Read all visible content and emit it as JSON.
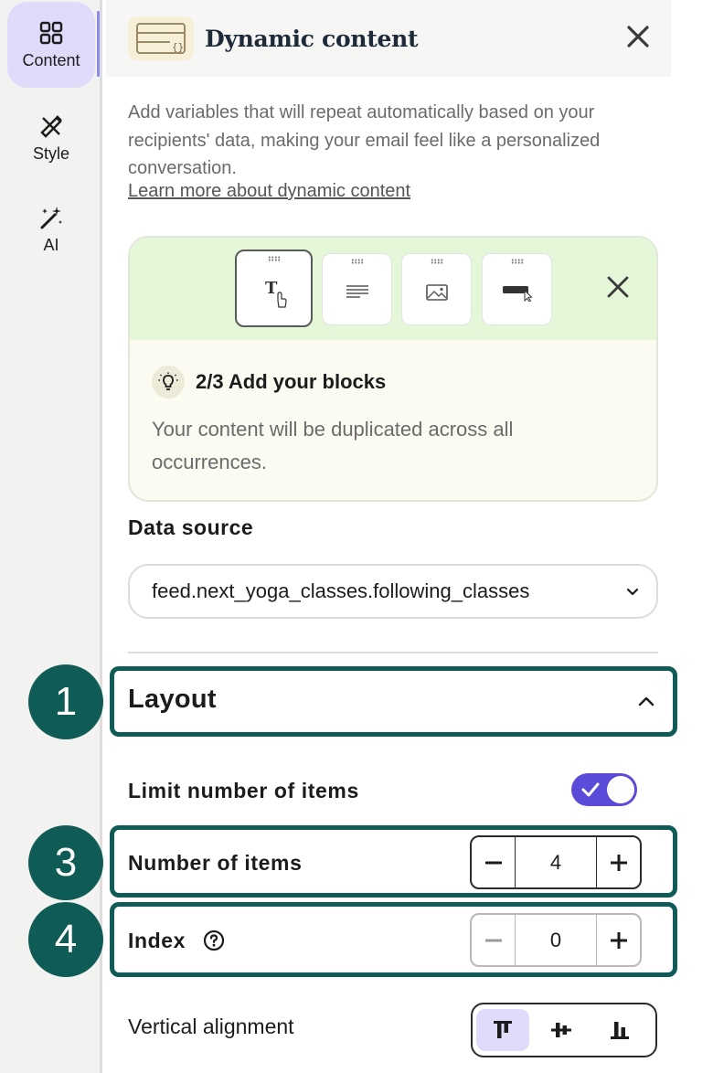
{
  "sidebar": {
    "items": [
      {
        "label": "Content",
        "icon": "grid-icon",
        "active": true
      },
      {
        "label": "Style",
        "icon": "pen-ruler-icon",
        "active": false
      },
      {
        "label": "AI",
        "icon": "magic-wand-icon",
        "active": false
      }
    ]
  },
  "header": {
    "title": "Dynamic content",
    "icon": "dynamic-content-icon"
  },
  "intro": {
    "text": "Add variables that will repeat automatically based on your recipients' data, making your email feel like a personalized conversation.",
    "link": "Learn more about dynamic content"
  },
  "onboarding": {
    "blocks": [
      "text-block-icon",
      "paragraph-block-icon",
      "image-block-icon",
      "button-block-icon"
    ],
    "tip_title": "2/3 Add your blocks",
    "tip_body": "Your content will be duplicated across all occurrences."
  },
  "data_source": {
    "label": "Data source",
    "value": "feed.next_yoga_classes.following_classes"
  },
  "layout": {
    "title": "Layout",
    "limit_label": "Limit number of items",
    "limit_enabled": true,
    "number_label": "Number of items",
    "number_value": "4",
    "index_label": "Index",
    "index_value": "0",
    "vertical_alignment_label": "Vertical alignment",
    "vertical_alignment_selected": "top"
  },
  "markers": [
    "1",
    "3",
    "4"
  ],
  "colors": {
    "accent": "#5a4bd8",
    "highlight": "#0e5c55",
    "active_bg": "#dedcfa",
    "card_top": "#e4f7d9"
  }
}
